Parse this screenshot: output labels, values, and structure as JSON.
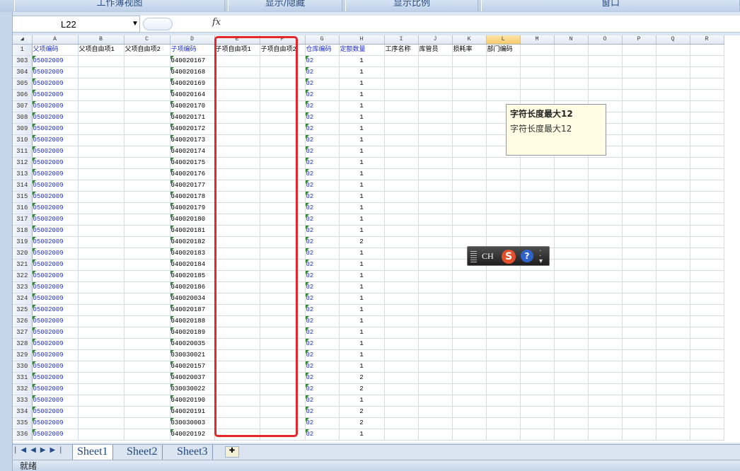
{
  "ribbon": {
    "groups": [
      "工作簿视图",
      "显示/隐藏",
      "显示比例",
      "窗口"
    ]
  },
  "formula_bar": {
    "name_box": "L22",
    "fx_label": "fx",
    "formula": ""
  },
  "columns": [
    "A",
    "B",
    "C",
    "D",
    "E",
    "F",
    "G",
    "H",
    "I",
    "J",
    "K",
    "L",
    "M",
    "N",
    "O",
    "P",
    "Q",
    "R"
  ],
  "selected_column": "L",
  "header_row": {
    "row_number": "1",
    "cells": [
      "父项编码",
      "父项自由项1",
      "父项自由项2",
      "子项编码",
      "子项自由项1",
      "子项自由项2",
      "仓库编码",
      "定额数量",
      "工序名称",
      "库管员",
      "损耗率",
      "部门编码",
      "",
      "",
      "",
      "",
      "",
      ""
    ]
  },
  "rows": [
    {
      "n": "303",
      "a": "05002009",
      "d": "040020167",
      "g": "02",
      "h": "1"
    },
    {
      "n": "304",
      "a": "05002009",
      "d": "040020168",
      "g": "02",
      "h": "1"
    },
    {
      "n": "305",
      "a": "05002009",
      "d": "040020169",
      "g": "02",
      "h": "1"
    },
    {
      "n": "306",
      "a": "05002009",
      "d": "040020164",
      "g": "02",
      "h": "1"
    },
    {
      "n": "307",
      "a": "05002009",
      "d": "040020170",
      "g": "02",
      "h": "1"
    },
    {
      "n": "308",
      "a": "05002009",
      "d": "040020171",
      "g": "02",
      "h": "1"
    },
    {
      "n": "309",
      "a": "05002009",
      "d": "040020172",
      "g": "02",
      "h": "1"
    },
    {
      "n": "310",
      "a": "05002009",
      "d": "040020173",
      "g": "02",
      "h": "1"
    },
    {
      "n": "311",
      "a": "05002009",
      "d": "040020174",
      "g": "02",
      "h": "1"
    },
    {
      "n": "312",
      "a": "05002009",
      "d": "040020175",
      "g": "02",
      "h": "1"
    },
    {
      "n": "313",
      "a": "05002009",
      "d": "040020176",
      "g": "02",
      "h": "1"
    },
    {
      "n": "314",
      "a": "05002009",
      "d": "040020177",
      "g": "02",
      "h": "1"
    },
    {
      "n": "315",
      "a": "05002009",
      "d": "040020178",
      "g": "02",
      "h": "1"
    },
    {
      "n": "316",
      "a": "05002009",
      "d": "040020179",
      "g": "02",
      "h": "1"
    },
    {
      "n": "317",
      "a": "05002009",
      "d": "040020180",
      "g": "02",
      "h": "1"
    },
    {
      "n": "318",
      "a": "05002009",
      "d": "040020181",
      "g": "02",
      "h": "1"
    },
    {
      "n": "319",
      "a": "05002009",
      "d": "040020182",
      "g": "02",
      "h": "2"
    },
    {
      "n": "320",
      "a": "05002009",
      "d": "040020183",
      "g": "02",
      "h": "1"
    },
    {
      "n": "321",
      "a": "05002009",
      "d": "040020184",
      "g": "02",
      "h": "1"
    },
    {
      "n": "322",
      "a": "05002009",
      "d": "040020185",
      "g": "02",
      "h": "1"
    },
    {
      "n": "323",
      "a": "05002009",
      "d": "040020186",
      "g": "02",
      "h": "1"
    },
    {
      "n": "324",
      "a": "05002009",
      "d": "040020034",
      "g": "02",
      "h": "1"
    },
    {
      "n": "325",
      "a": "05002009",
      "d": "040020187",
      "g": "02",
      "h": "1"
    },
    {
      "n": "326",
      "a": "05002009",
      "d": "040020188",
      "g": "02",
      "h": "1"
    },
    {
      "n": "327",
      "a": "05002009",
      "d": "040020189",
      "g": "02",
      "h": "1"
    },
    {
      "n": "328",
      "a": "05002009",
      "d": "040020035",
      "g": "02",
      "h": "1"
    },
    {
      "n": "329",
      "a": "05002009",
      "d": "030030021",
      "g": "02",
      "h": "1"
    },
    {
      "n": "330",
      "a": "05002009",
      "d": "040020157",
      "g": "02",
      "h": "1"
    },
    {
      "n": "331",
      "a": "05002009",
      "d": "040020037",
      "g": "02",
      "h": "2"
    },
    {
      "n": "332",
      "a": "05002009",
      "d": "030030022",
      "g": "02",
      "h": "2"
    },
    {
      "n": "333",
      "a": "05002009",
      "d": "040020190",
      "g": "02",
      "h": "1"
    },
    {
      "n": "334",
      "a": "05002009",
      "d": "040020191",
      "g": "02",
      "h": "2"
    },
    {
      "n": "335",
      "a": "05002009",
      "d": "030030003",
      "g": "02",
      "h": "2"
    },
    {
      "n": "336",
      "a": "05002009",
      "d": "040020192",
      "g": "02",
      "h": "1"
    }
  ],
  "tooltip": {
    "title": "字符长度最大12",
    "body": "字符长度最大12"
  },
  "ime": {
    "mode": "CH",
    "logo": "S",
    "help": "?"
  },
  "sheet_tabs": [
    "Sheet1",
    "Sheet2",
    "Sheet3"
  ],
  "active_tab": "Sheet1",
  "status": {
    "text": "就绪"
  },
  "colors": {
    "highlight_box": "#e5262a",
    "link_blue": "#1d2fd0",
    "selected_header": "#f8c96b"
  }
}
